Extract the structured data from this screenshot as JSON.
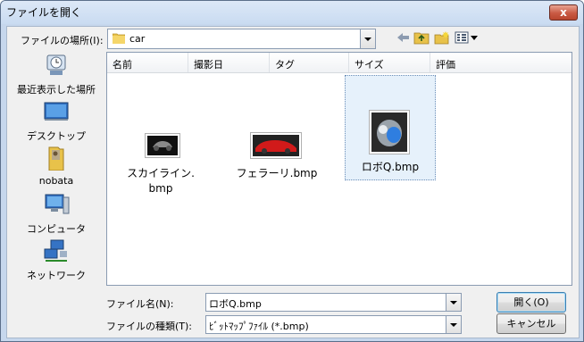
{
  "window": {
    "title": "ファイルを開く",
    "close_label": "x"
  },
  "lookin": {
    "label": "ファイルの場所(I):",
    "value": "car"
  },
  "places": [
    {
      "label": "最近表示した場所",
      "icon": "recent-places-icon"
    },
    {
      "label": "デスクトップ",
      "icon": "desktop-icon"
    },
    {
      "label": "nobata",
      "icon": "user-folder-icon"
    },
    {
      "label": "コンピュータ",
      "icon": "computer-icon"
    },
    {
      "label": "ネットワーク",
      "icon": "network-icon"
    }
  ],
  "columns": [
    "名前",
    "撮影日",
    "タグ",
    "サイズ",
    "評価"
  ],
  "files": [
    {
      "name_line1": "スカイライン.",
      "name_line2": "bmp"
    },
    {
      "name_line1": "フェラーリ.bmp",
      "name_line2": ""
    },
    {
      "name_line1": "ロボQ.bmp",
      "name_line2": ""
    }
  ],
  "filename": {
    "label": "ファイル名(N):",
    "value": "ロボQ.bmp"
  },
  "filetype": {
    "label": "ファイルの種類(T):",
    "value": "ﾋﾞｯﾄﾏｯﾌﾟﾌｧｲﾙ (*.bmp)"
  },
  "buttons": {
    "open": "開く(O)",
    "cancel": "キャンセル"
  },
  "colors": {
    "titlebar": "#c9dbf1",
    "close": "#c95a43",
    "selection": "#e6f1fb"
  }
}
